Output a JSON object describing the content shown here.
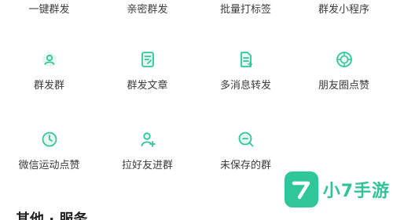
{
  "top_row": [
    {
      "label": "一键群发"
    },
    {
      "label": "亲密群发"
    },
    {
      "label": "批量打标签"
    },
    {
      "label": "群发小程序"
    }
  ],
  "row2": [
    {
      "label": "群发群",
      "icon": "group-send-icon"
    },
    {
      "label": "群发文章",
      "icon": "article-send-icon"
    },
    {
      "label": "多消息转发",
      "icon": "multi-message-forward-icon"
    },
    {
      "label": "朋友圈点赞",
      "icon": "moments-like-icon"
    }
  ],
  "row3": [
    {
      "label": "微信运动点赞",
      "icon": "wechat-sport-like-icon"
    },
    {
      "label": "拉好友进群",
      "icon": "invite-friend-icon"
    },
    {
      "label": "未保存的群",
      "icon": "unsaved-group-icon"
    }
  ],
  "watermark": {
    "text": "小7手游"
  },
  "section": {
    "title": "其他 · 服务"
  },
  "colors": {
    "accent": "#2fc79a",
    "text": "#3c3c3c",
    "background": "#ffffff"
  }
}
